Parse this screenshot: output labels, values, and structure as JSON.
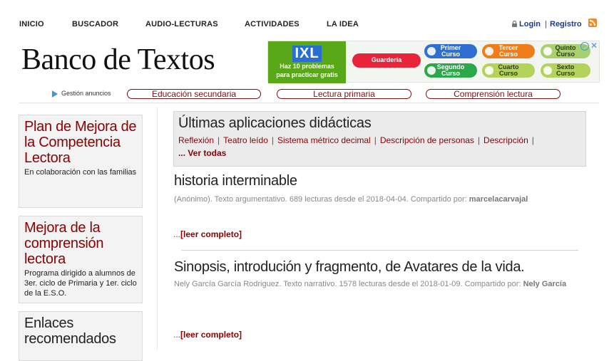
{
  "nav": {
    "items": [
      "INICIO",
      "BUSCADOR",
      "AUDIO-LECTURAS",
      "ACTIVIDADES",
      "LA IDEA"
    ],
    "login": "Login",
    "separator": "|",
    "register": "Registro",
    "icons": [
      "lock-icon",
      "rss-icon"
    ]
  },
  "logo": "Banco de Textos",
  "ad": {
    "brand": "IXL",
    "tagline_1": "Haz 10 problemas",
    "tagline_2": "para practicar gratis",
    "pills": [
      {
        "line1": "Guardería",
        "line2": "",
        "color": "#e8243a"
      },
      {
        "line1": "Primer",
        "line2": "Curso",
        "color": "#2f6fd1"
      },
      {
        "line1": "Tercer",
        "line2": "Curso",
        "color": "#f07d1a"
      },
      {
        "line1": "Quinto",
        "line2": "Curso",
        "color": "#a9d06e"
      },
      {
        "line1": "Segundo",
        "line2": "Curso",
        "color": "#2aa84a"
      },
      {
        "line1": "Cuarto",
        "line2": "Curso",
        "color": "#b4d35a"
      },
      {
        "line1": "Sexto",
        "line2": "Curso",
        "color": "#b4d35a"
      }
    ],
    "close": "✕"
  },
  "tags": {
    "ad_manage": "Gestión anuncios",
    "items": [
      "Educación secundaria",
      "Lectura primaria",
      "Comprensión lectura"
    ]
  },
  "sidebar": [
    {
      "title": "Plan de Mejora de la Competencia Lectora",
      "desc": "En colaboración con las familias"
    },
    {
      "title": "Mejora de la comprensión lectora",
      "desc": "Programa dirigido a alumnos de 3er. ciclo de Primaria y 1er. ciclo de la E.S.O."
    },
    {
      "title": "Enlaces recomendados",
      "desc": ""
    }
  ],
  "apps": {
    "title": "Últimas aplicaciones didácticas",
    "links": [
      "Reflexión",
      "Teatro leído",
      "Sistema métrico decimal",
      "Descripción de personas",
      "Descripción"
    ],
    "more": "... Ver todas"
  },
  "articles": [
    {
      "title": "historia interminable",
      "meta": "(Anónimo). Texto argumentativo. 689 lecturas desde el 2018-04-04. Compartido por:",
      "author": "marcelacarvajal",
      "readmore_dots": "...",
      "readmore": "[leer completo]"
    },
    {
      "title": "Sinopsis, introdución y fragmento, de Avatares de la vida.",
      "meta": "Nely García García Rodriguez. Texto narrativo. 1578 lecturas desde el 2018-01-09. Compartido por:",
      "author": "Nely García",
      "readmore_dots": "...",
      "readmore": "[leer completo]"
    }
  ]
}
